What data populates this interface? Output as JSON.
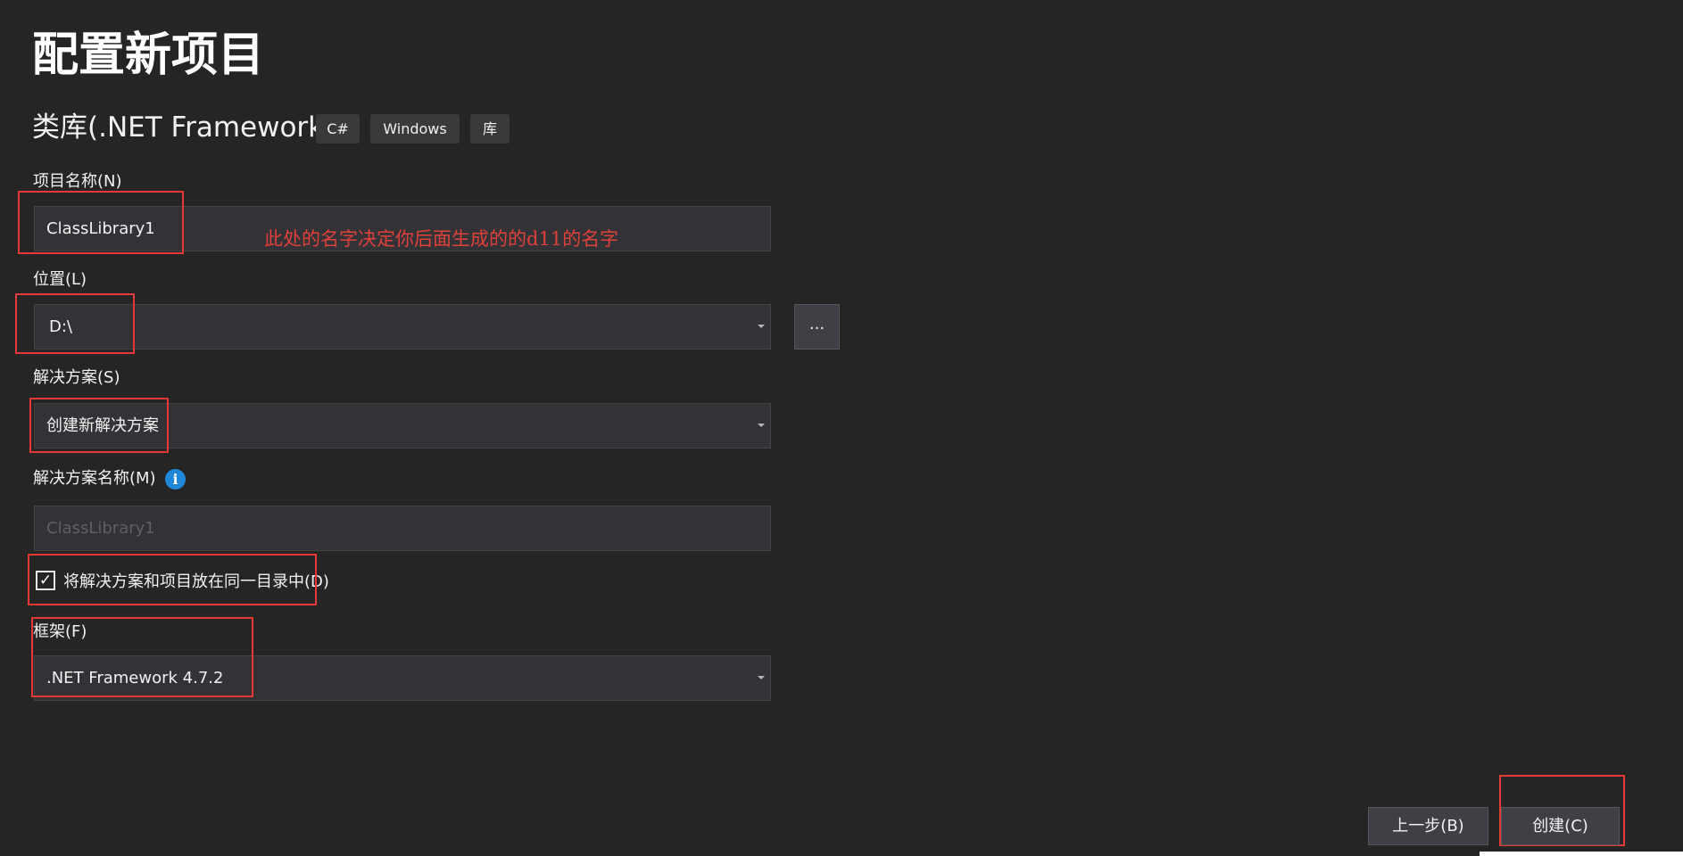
{
  "page_title": "配置新项目",
  "template": {
    "name": "类库(.NET Framework)",
    "tags": [
      "C#",
      "Windows",
      "库"
    ]
  },
  "project_name": {
    "label": "项目名称(N)",
    "value": "ClassLibrary1"
  },
  "location": {
    "label": "位置(L)",
    "value": "D:\\",
    "browse_label": "..."
  },
  "solution": {
    "label": "解决方案(S)",
    "value": "创建新解决方案"
  },
  "solution_name": {
    "label": "解决方案名称(M)",
    "info_icon": "i",
    "placeholder": "ClassLibrary1"
  },
  "same_directory": {
    "checked": true,
    "check_mark": "✓",
    "label": "将解决方案和项目放在同一目录中(D)"
  },
  "framework": {
    "label": "框架(F)",
    "value": ".NET Framework 4.7.2"
  },
  "annotation": {
    "note": "此处的名字决定你后面生成的的d11的名字",
    "color": "#e0403a"
  },
  "footer": {
    "back_label": "上一步(B)",
    "create_label": "创建(C)"
  },
  "colors": {
    "background": "#252526",
    "field": "#333337",
    "button": "#3f3f46",
    "annotation_box": "#e53935",
    "info_icon": "#1f88d8"
  }
}
